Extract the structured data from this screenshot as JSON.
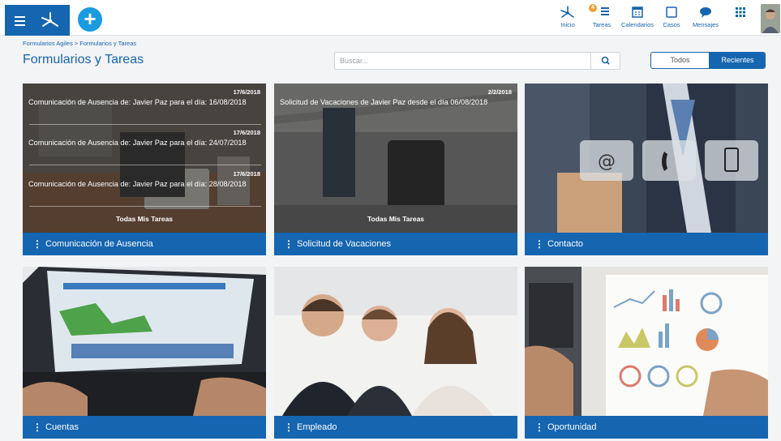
{
  "header": {
    "nav": [
      {
        "label": "Inicio",
        "icon": "home-icon"
      },
      {
        "label": "Tareas",
        "icon": "tasks-icon",
        "badge": "4"
      },
      {
        "label": "Calendarios",
        "icon": "calendar-icon"
      },
      {
        "label": "Casos",
        "icon": "cases-icon"
      },
      {
        "label": "Mensajes",
        "icon": "messages-icon"
      },
      {
        "label": "",
        "icon": "apps-grid-icon"
      }
    ]
  },
  "breadcrumb": "Formularios Agiles > Formularios y Tareas",
  "title": "Formularios y Tareas",
  "search": {
    "placeholder": "Buscar..."
  },
  "filter": {
    "all": "Todos",
    "recent": "Recientes",
    "active": "Recientes"
  },
  "colors": {
    "primary": "#1565b0",
    "accent": "#1a9be0",
    "badge": "#f0a030"
  },
  "cards": [
    {
      "name": "Comunicación de Ausencia",
      "notifications": [
        {
          "date": "17/6/2018",
          "text": "Comunicación de Ausencia de: Javier Paz para el día: 16/08/2018"
        },
        {
          "date": "17/6/2018",
          "text": "Comunicación de Ausencia de: Javier Paz para el día: 24/07/2018"
        },
        {
          "date": "17/6/2018",
          "text": "Comunicación de Ausencia de: Javier Paz para el día: 28/08/2018"
        }
      ],
      "all_tasks": "Todas Mis Tareas"
    },
    {
      "name": "Solicitud de Vacaciones",
      "notifications": [
        {
          "date": "2/2/2018",
          "text": "Solicitud de Vacaciones de Javier  Paz desde el día 06/08/2018"
        }
      ],
      "all_tasks": "Todas Mis Tareas"
    },
    {
      "name": "Contacto"
    },
    {
      "name": "Cuentas"
    },
    {
      "name": "Empleado"
    },
    {
      "name": "Oportunidad"
    }
  ]
}
